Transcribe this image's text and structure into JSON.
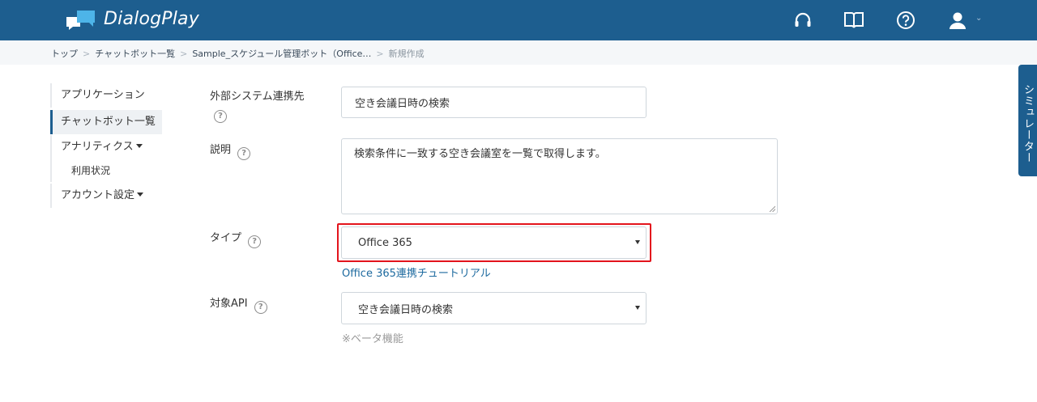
{
  "header": {
    "app_name": "DialogPlay",
    "icons": [
      "support-headset-icon",
      "manual-book-icon",
      "help-circle-icon",
      "user-icon"
    ],
    "brand_color": "#1d5e8f"
  },
  "breadcrumb": {
    "items": [
      "トップ",
      "チャットボット一覧",
      "Sample_スケジュール管理ボット（Office…"
    ],
    "current": "新規作成"
  },
  "sidenav": {
    "applications": "アプリケーション",
    "chatbots": "チャットボット一覧",
    "analytics": "アナリティクス",
    "usage": "利用状況",
    "account": "アカウント設定"
  },
  "form": {
    "external_system_label": "外部システム連携先",
    "external_system_value": "空き会議日時の検索",
    "description_label": "説明",
    "description_value": "検索条件に一致する空き会議室を一覧で取得します。",
    "type_label": "タイプ",
    "type_value": "Office 365",
    "type_link": "Office 365連携チュートリアル",
    "api_label": "対象API",
    "api_value": "空き会議日時の検索",
    "api_note": "※ベータ機能",
    "highlight_color": "#e3141c"
  },
  "simulator_tab": "シミュレーター"
}
